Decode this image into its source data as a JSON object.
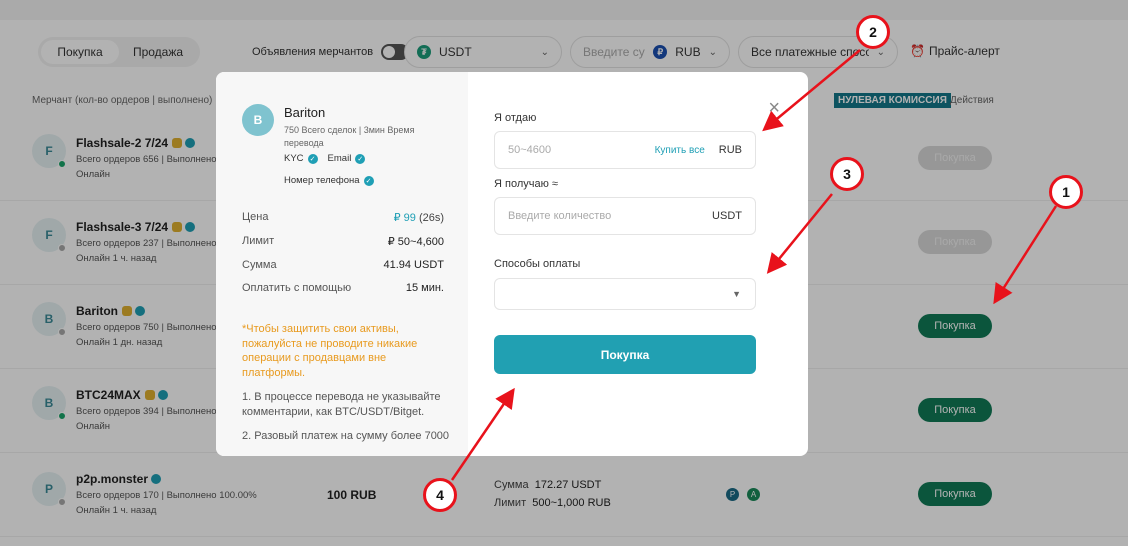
{
  "header": {
    "tabs": [
      {
        "label": "Покупка"
      },
      {
        "label": "Продажа"
      }
    ],
    "merchant_ads_label": "Объявления мерчантов",
    "crypto_select": "USDT",
    "amount_placeholder": "Введите сумм",
    "fiat_select": "RUB",
    "payment_select": "Все платежные способ",
    "price_alert": "Прайс-алерт"
  },
  "table": {
    "merchant_col": "Мерчант (кол-во ордеров | выполнено)",
    "zero_fee": "НУЛЕВАЯ КОМИССИЯ",
    "actions_col": "Действия",
    "rows": [
      {
        "initial": "F",
        "name": "Flashsale-2 7/24",
        "stats": "Всего ордеров 656 | Выполнено",
        "status": "Онлайн",
        "button": "Покупка"
      },
      {
        "initial": "F",
        "name": "Flashsale-3 7/24",
        "stats": "Всего ордеров 237 | Выполнено",
        "status": "Онлайн 1 ч. назад",
        "button": "Покупка"
      },
      {
        "initial": "B",
        "name": "Bariton",
        "stats": "Всего ордеров 750 | Выполнено",
        "status": "Онлайн 1 дн. назад",
        "button": "Покупка"
      },
      {
        "initial": "B",
        "name": "BTC24MAX",
        "stats": "Всего ордеров 394 | Выполнено",
        "status": "Онлайн",
        "button": "Покупка"
      },
      {
        "initial": "P",
        "name": "p2p.monster",
        "stats": "Всего ордеров 170 | Выполнено 100.00%",
        "status": "Онлайн 1 ч. назад",
        "button": "Покупка",
        "price": "100 RUB",
        "sum_label": "Сумма",
        "sum": "172.27 USDT",
        "limit_label": "Лимит",
        "limit": "500~1,000 RUB"
      }
    ]
  },
  "modal": {
    "seller": {
      "initial": "B",
      "name": "Bariton",
      "stats": "750 Всего сделок | 3мин Время перевода",
      "kyc": "KYC",
      "email": "Email",
      "phone": "Номер телефона"
    },
    "info": {
      "price_label": "Цена",
      "price_value": "₽ 99",
      "price_timer": "(26s)",
      "limit_label": "Лимит",
      "limit_value": "₽ 50~4,600",
      "amount_label": "Сумма",
      "amount_value": "41.94 USDT",
      "pay_label": "Оплатить с помощью",
      "pay_value": "15 мин."
    },
    "warning": "*Чтобы защитить свои активы, пожалуйста не проводите никакие операции с продавцами вне платформы.",
    "note1": "1. В процессе перевода не указывайте комментарии, как BTC/USDT/Bitget.",
    "note2": "2. Разовый платеж на сумму более 7000",
    "form": {
      "give_label": "Я отдаю",
      "give_placeholder": "50~4600",
      "buy_all": "Купить все",
      "give_unit": "RUB",
      "get_label": "Я получаю ≈",
      "get_placeholder": "Введите количество",
      "get_unit": "USDT",
      "payment_label": "Способы оплаты",
      "submit": "Покупка"
    }
  },
  "markers": [
    "1",
    "2",
    "3",
    "4"
  ],
  "colors": {
    "accent": "#21a0b2",
    "buy": "#107a56",
    "annotation": "#e8121b",
    "warning": "#e89a1e"
  }
}
